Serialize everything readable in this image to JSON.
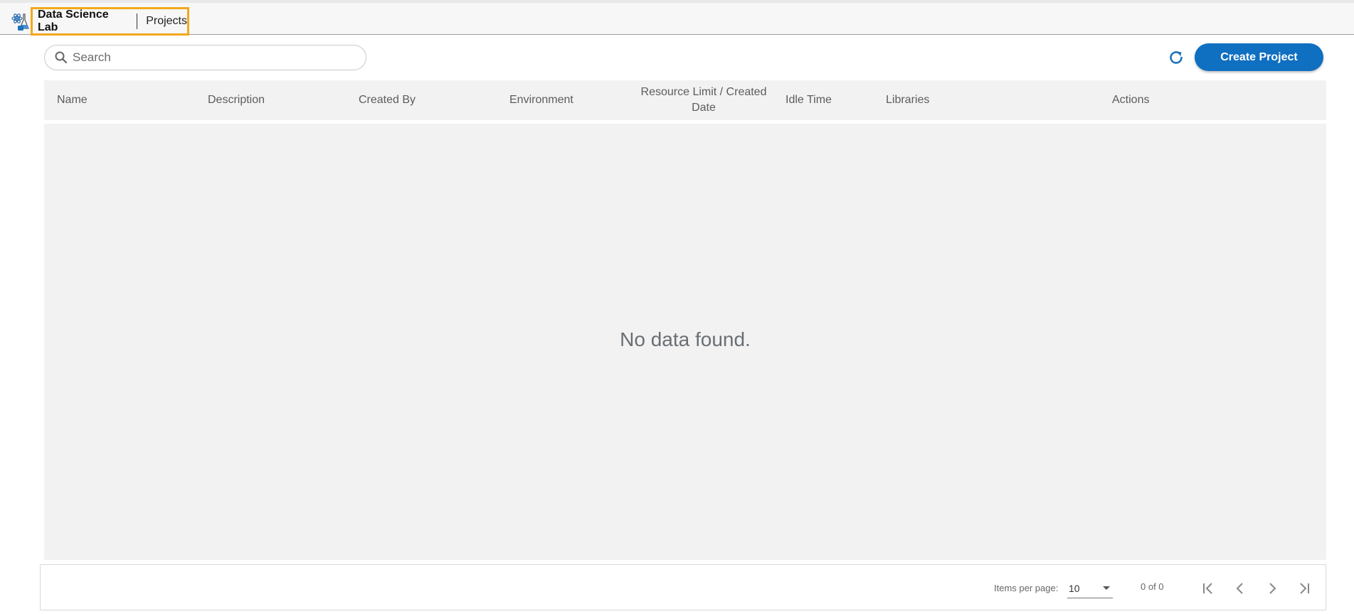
{
  "header": {
    "app_name": "Data Science Lab",
    "page_name": "Projects",
    "logo_icon": "atom-flask-icon",
    "highlight_color": "#f2a81d"
  },
  "toolbar": {
    "search_placeholder": "Search",
    "search_value": "",
    "refresh_icon": "refresh-icon",
    "create_label": "Create Project",
    "accent_color": "#0f6fc1"
  },
  "table": {
    "columns": [
      "Name",
      "Description",
      "Created By",
      "Environment",
      "Resource Limit / Created Date",
      "Idle Time",
      "Libraries",
      "Actions"
    ],
    "rows": [],
    "empty_message": "No data found."
  },
  "pagination": {
    "items_per_page_label": "Items per page:",
    "items_per_page_value": "10",
    "range_label": "0 of 0",
    "buttons": [
      "first-page-icon",
      "prev-page-icon",
      "next-page-icon",
      "last-page-icon"
    ]
  }
}
